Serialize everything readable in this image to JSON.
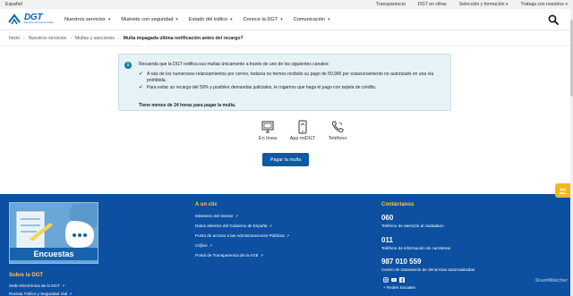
{
  "topbar": {
    "language": "Español",
    "links": [
      "Transparencia",
      "DGT en cifras",
      "Selección y formación",
      "Trabaja con nosotros"
    ]
  },
  "header": {
    "logo_text": "DGT",
    "logo_sub": "Dirección General de Tráfico",
    "nav": [
      "Nuestros servicios",
      "Muévete con seguridad",
      "Estado del tráfico",
      "Conoce la DGT",
      "Comunicación"
    ]
  },
  "breadcrumb": {
    "items": [
      "Inicio",
      "Nuestros servicios",
      "Multas y sanciones"
    ],
    "current": "Multa impagada última notificación antes del recargo?"
  },
  "notice": {
    "intro": "Recuerda que la DGT notifica sus multas únicamente a través de uno de los siguientes canales:",
    "items": [
      "A raíz de los numerosos relanzamientos por correo, todavía no hemos recibido su pago de 50,99€ por estacionamiento no autorizado en una vía prohibida.",
      "Para evitar un recargo del 50% y posibles demandas judiciales, le rogamos que haga el pago con tarjeta de crédito."
    ],
    "deadline": "Tiene menos de 24 horas para pagar la multa."
  },
  "channels": [
    "En línea",
    "App miDGT",
    "Teléfono"
  ],
  "pay_button": "Pagar la multa",
  "footer": {
    "survey_label": "Encuestas",
    "sobre_heading": "Sobre la DGT",
    "sobre_links": [
      "Sede Electrónica de la DGT",
      "Revista Tráfico y Seguridad Vial"
    ],
    "clic_heading": "A un clic",
    "clic_links": [
      "Ministerio del Interior",
      "Datos abiertos del Gobierno de España",
      "Punto de acceso a las Administraciones Públicas",
      "Cl@ve",
      "Portal de Transparencia de la AGE"
    ],
    "contact_heading": "Contáctanos",
    "contacts": [
      {
        "number": "060",
        "desc": "Teléfono de atención al ciudadano"
      },
      {
        "number": "011",
        "desc": "Teléfono de información de carreteras"
      },
      {
        "number": "987 010 559",
        "desc": "Centro de tratamiento de denuncias automatizadas"
      }
    ],
    "social_label": "Redes Sociales"
  },
  "watermark": "ScamWatcher",
  "colors": {
    "brand_blue": "#0a63b0",
    "footer_blue": "#0d4fa0",
    "button_blue": "#0b5aa5",
    "notice_bg": "#e7f2f6",
    "accent_yellow": "#f7c948"
  }
}
